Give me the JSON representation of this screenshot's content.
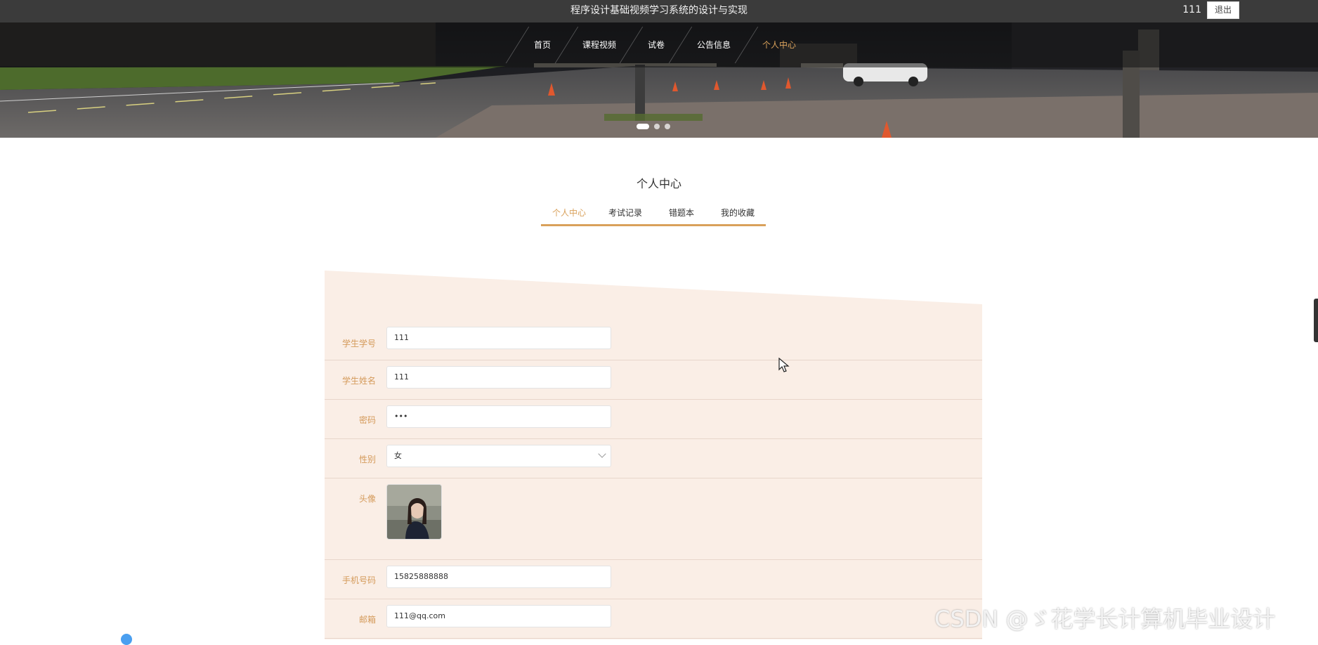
{
  "header": {
    "title": "程序设计基础视频学习系统的设计与实现",
    "username": "111",
    "logout_label": "退出"
  },
  "nav": {
    "items": [
      {
        "label": "首页",
        "active": false
      },
      {
        "label": "课程视频",
        "active": false
      },
      {
        "label": "试卷",
        "active": false
      },
      {
        "label": "公告信息",
        "active": false
      },
      {
        "label": "个人中心",
        "active": true
      }
    ]
  },
  "carousel": {
    "slides": 3,
    "active_index": 1
  },
  "section": {
    "title": "个人中心",
    "tabs": [
      {
        "label": "个人中心",
        "active": true
      },
      {
        "label": "考试记录",
        "active": false
      },
      {
        "label": "错题本",
        "active": false
      },
      {
        "label": "我的收藏",
        "active": false
      }
    ]
  },
  "form": {
    "student_id": {
      "label": "学生学号",
      "value": "111"
    },
    "student_name": {
      "label": "学生姓名",
      "value": "111"
    },
    "password": {
      "label": "密码",
      "value": "•••"
    },
    "gender": {
      "label": "性别",
      "value": "女"
    },
    "avatar": {
      "label": "头像"
    },
    "phone": {
      "label": "手机号码",
      "value": "15825888888"
    },
    "email": {
      "label": "邮箱",
      "value": "111@qq.com"
    }
  },
  "watermark": "CSDN @ゞ花学长计算机毕业设计",
  "colors": {
    "accent": "#d9a15b",
    "topbar": "#3b3b3b",
    "panel": "#faeee6",
    "label": "#d49a5a"
  }
}
